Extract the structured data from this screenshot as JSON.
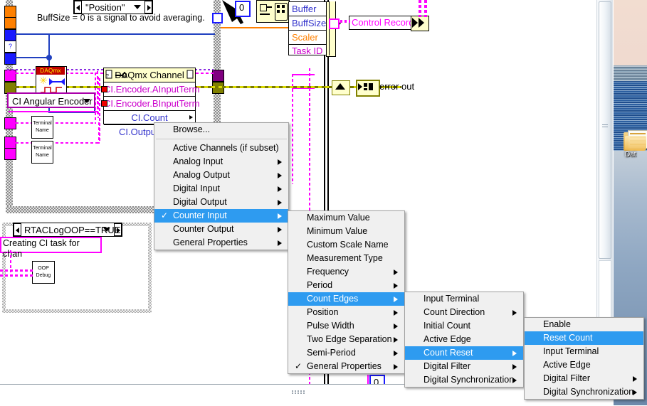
{
  "diagram": {
    "position_control": {
      "value": "\"Position\""
    },
    "comment": "BuffSize = 0 is a signal to avoid averaging.",
    "constant_zero_top": "0",
    "constant_zero_bottom": "0",
    "cluster_labels": [
      "Buffer",
      "BuffSize",
      "Scaler",
      "Task ID"
    ],
    "control_records_label": "Control Records",
    "error_out_label": "error out",
    "daqmx_icon_label": "DAQmx",
    "channel_combo_value": "CI Angular Encoder",
    "terminal_nodes": [
      "Terminal Name",
      "Terminal Name"
    ],
    "property_node": {
      "title": "DAQmx Channel",
      "rows": [
        "CI.Encoder.AInputTerm",
        "CI.Encoder.BInputTerm",
        "CI.Count",
        "CI.OutputState"
      ]
    },
    "case_selector": "RTACLogOOP==TRUE",
    "string_constant": "Creating CI task for chan",
    "oop_debug_label": "OOP Debug"
  },
  "menus": {
    "level1": {
      "name": "property-root-menu",
      "items": [
        {
          "label": "Browse...",
          "submenu": false,
          "checked": false,
          "selected": false
        },
        {
          "separator": true
        },
        {
          "label": "Active Channels (if subset)",
          "submenu": false,
          "checked": false,
          "selected": false
        },
        {
          "label": "Analog Input",
          "submenu": true,
          "checked": false,
          "selected": false
        },
        {
          "label": "Analog Output",
          "submenu": true,
          "checked": false,
          "selected": false
        },
        {
          "label": "Digital Input",
          "submenu": true,
          "checked": false,
          "selected": false
        },
        {
          "label": "Digital Output",
          "submenu": true,
          "checked": false,
          "selected": false
        },
        {
          "label": "Counter Input",
          "submenu": true,
          "checked": true,
          "selected": true
        },
        {
          "label": "Counter Output",
          "submenu": true,
          "checked": false,
          "selected": false
        },
        {
          "label": "General Properties",
          "submenu": true,
          "checked": false,
          "selected": false
        }
      ]
    },
    "level2": {
      "name": "counter-input-submenu",
      "items": [
        {
          "label": "Maximum Value",
          "submenu": false,
          "checked": false,
          "selected": false
        },
        {
          "label": "Minimum Value",
          "submenu": false,
          "checked": false,
          "selected": false
        },
        {
          "label": "Custom Scale Name",
          "submenu": false,
          "checked": false,
          "selected": false
        },
        {
          "label": "Measurement Type",
          "submenu": false,
          "checked": false,
          "selected": false
        },
        {
          "label": "Frequency",
          "submenu": true,
          "checked": false,
          "selected": false
        },
        {
          "label": "Period",
          "submenu": true,
          "checked": false,
          "selected": false
        },
        {
          "label": "Count Edges",
          "submenu": true,
          "checked": false,
          "selected": true
        },
        {
          "label": "Position",
          "submenu": true,
          "checked": false,
          "selected": false
        },
        {
          "label": "Pulse Width",
          "submenu": true,
          "checked": false,
          "selected": false
        },
        {
          "label": "Two Edge Separation",
          "submenu": true,
          "checked": false,
          "selected": false
        },
        {
          "label": "Semi-Period",
          "submenu": true,
          "checked": false,
          "selected": false
        },
        {
          "label": "General Properties",
          "submenu": true,
          "checked": true,
          "selected": false
        }
      ]
    },
    "level3": {
      "name": "count-edges-submenu",
      "items": [
        {
          "label": "Input Terminal",
          "submenu": false,
          "checked": false,
          "selected": false
        },
        {
          "label": "Count Direction",
          "submenu": true,
          "checked": false,
          "selected": false
        },
        {
          "label": "Initial Count",
          "submenu": false,
          "checked": false,
          "selected": false
        },
        {
          "label": "Active Edge",
          "submenu": false,
          "checked": false,
          "selected": false
        },
        {
          "label": "Count Reset",
          "submenu": true,
          "checked": false,
          "selected": true
        },
        {
          "label": "Digital Filter",
          "submenu": true,
          "checked": false,
          "selected": false
        },
        {
          "label": "Digital Synchronization",
          "submenu": true,
          "checked": false,
          "selected": false
        }
      ]
    },
    "level4": {
      "name": "count-reset-submenu",
      "items": [
        {
          "label": "Enable",
          "submenu": false,
          "checked": false,
          "selected": false
        },
        {
          "label": "Reset Count",
          "submenu": false,
          "checked": false,
          "selected": true
        },
        {
          "label": "Input Terminal",
          "submenu": false,
          "checked": false,
          "selected": false
        },
        {
          "label": "Active Edge",
          "submenu": false,
          "checked": false,
          "selected": false
        },
        {
          "label": "Digital Filter",
          "submenu": true,
          "checked": false,
          "selected": false
        },
        {
          "label": "Digital Synchronization",
          "submenu": true,
          "checked": false,
          "selected": false
        }
      ]
    }
  },
  "desktop": {
    "folder_label": "Dat",
    "highlight_color": "#2e9bf0"
  }
}
